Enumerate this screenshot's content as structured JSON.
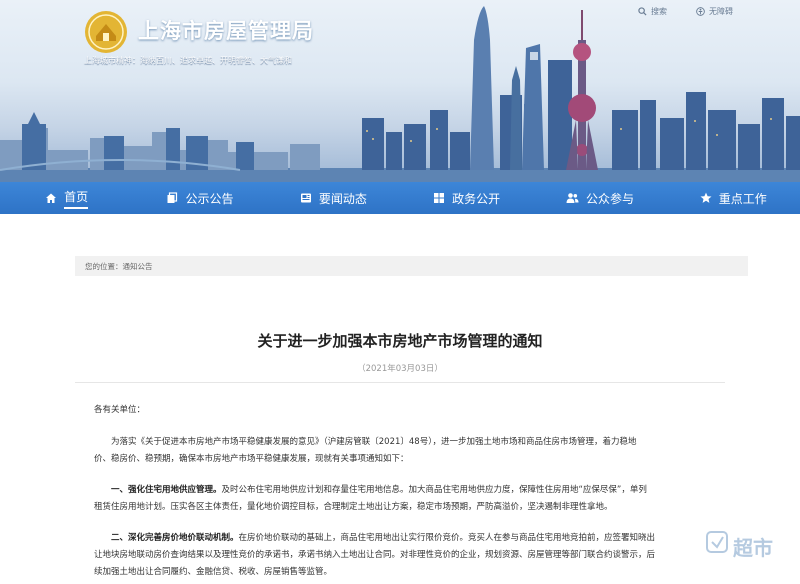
{
  "site": {
    "title": "上海市房屋管理局",
    "spirit": "上海城市精神：海纳百川、追求卓越、开明睿智、大气谦和",
    "utility": {
      "search": "搜索",
      "accessibility": "无障碍"
    }
  },
  "nav": [
    {
      "label": "首页",
      "icon": "home-icon"
    },
    {
      "label": "公示公告",
      "icon": "copy-icon"
    },
    {
      "label": "要闻动态",
      "icon": "news-icon"
    },
    {
      "label": "政务公开",
      "icon": "grid-icon"
    },
    {
      "label": "公众参与",
      "icon": "users-icon"
    },
    {
      "label": "重点工作",
      "icon": "star-icon"
    }
  ],
  "breadcrumb": {
    "prefix": "您的位置：",
    "current": "通知公告"
  },
  "article": {
    "title": "关于进一步加强本市房地产市场管理的通知",
    "date": "（2021年03月03日）",
    "salutation": "各有关单位：",
    "intro_1": "为落实《关于促进本市房地产市场平稳健康发展的意见》（沪建房管联〔2021〕48号），进一步加强土地市场和商品住房市场管理，着力稳地",
    "intro_2": "价、稳房价、稳预期，确保本市房地产市场平稳健康发展，现就有关事项通知如下：",
    "s1_head": "一、强化住宅用地供应管理。",
    "s1_line1": "及时公布住宅用地供应计划和存量住宅用地信息。加大商品住宅用地供应力度，保障性住房用地“应保尽保”，单列",
    "s1_line2": "租赁住房用地计划。压实各区主体责任，量化地价调控目标，合理制定土地出让方案，稳定市场预期，严防高溢价，坚决遏制非理性拿地。",
    "s2_head": "二、深化完善房价地价联动机制。",
    "s2_line1": "在房价地价联动的基础上，商品住宅用地出让实行限价竞价。竞买人在参与商品住宅用地竞拍前，应签署知晓出",
    "s2_line2": "让地块房地联动房价查询结果以及理性竞价的承诺书，承诺书纳入土地出让合同。对非理性竞价的企业，规划资源、房屋管理等部门联合约谈警示，后",
    "s2_line3": "续加强土地出让合同履约、金融信贷、税收、房屋销售等监管。"
  },
  "watermark": "超市",
  "colors": {
    "nav": "#3279cd",
    "title_text": "#ffffff",
    "accent": "#2e73c6"
  }
}
